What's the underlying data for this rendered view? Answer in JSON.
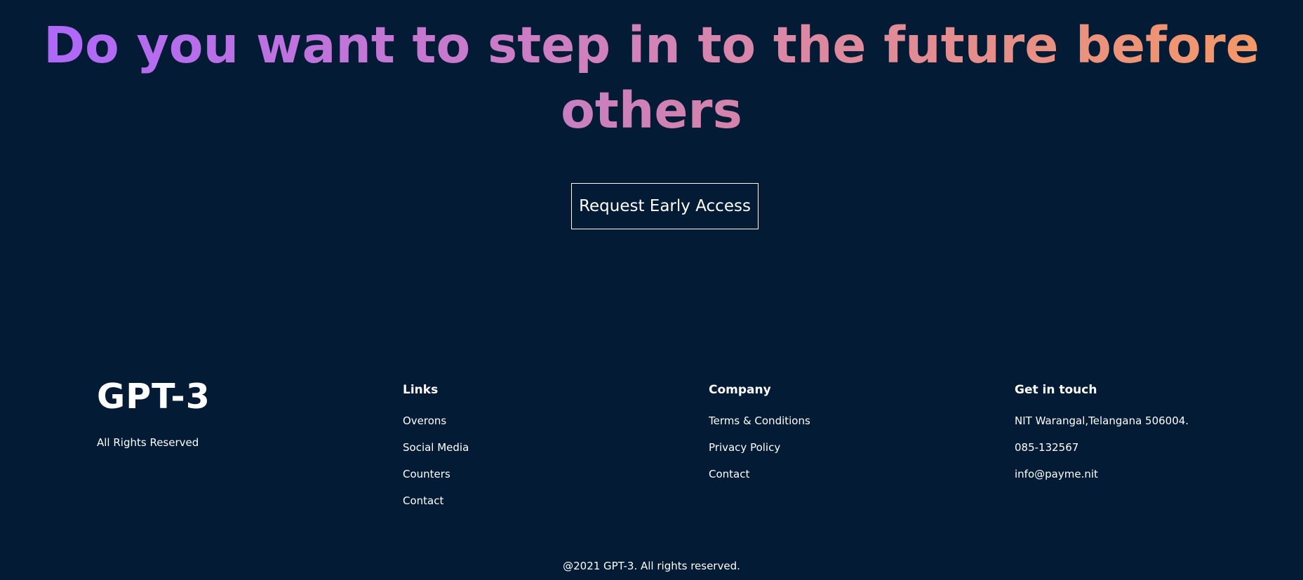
{
  "hero": {
    "heading_line1": "Do you want to step in to the future before",
    "heading_line2": "others",
    "button_label": "Request Early Access"
  },
  "footer": {
    "logo": "GPT-3",
    "rights": "All Rights Reserved",
    "links": {
      "title": "Links",
      "items": [
        "Overons",
        "Social Media",
        "Counters",
        "Contact"
      ]
    },
    "company": {
      "title": "Company",
      "items": [
        "Terms & Conditions",
        "Privacy Policy",
        "Contact"
      ]
    },
    "contact": {
      "title": "Get in touch",
      "items": [
        "NIT Warangal,Telangana 506004.",
        "085-132567",
        "info@payme.nit"
      ]
    },
    "copyright": "@2021 GPT-3. All rights reserved."
  },
  "colors": {
    "background": "#031b34",
    "gradient_start": "#ae67fa",
    "gradient_end": "#f49867",
    "text": "#ffffff"
  }
}
